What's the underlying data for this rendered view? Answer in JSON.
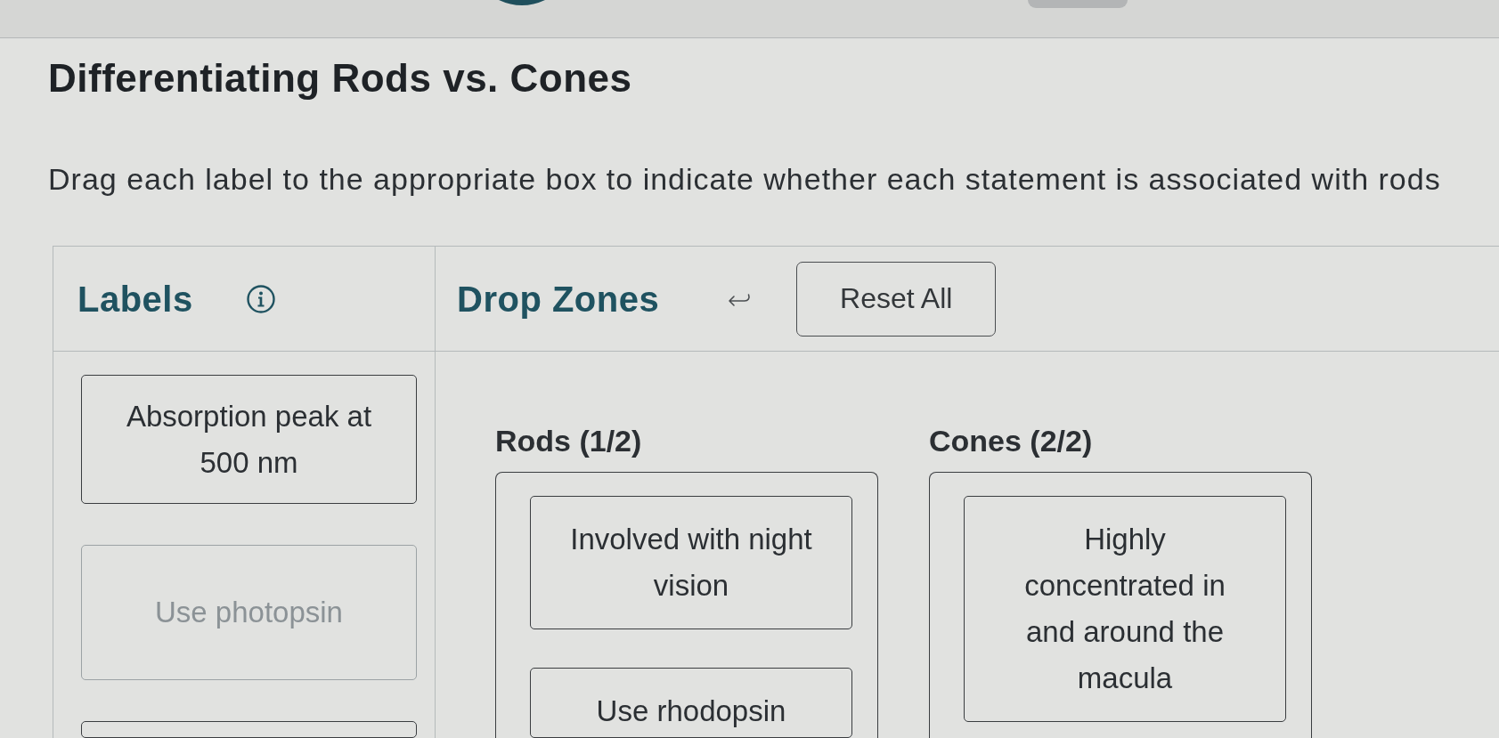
{
  "top_bar": {
    "marks": [
      {
        "kind": "circle"
      },
      {
        "kind": "tab"
      }
    ]
  },
  "title": "Differentiating Rods vs. Cones",
  "instructions": "Drag each label to the appropriate box to indicate whether each statement is associated with rods",
  "labels_panel": {
    "heading": "Labels"
  },
  "drop_zones_panel": {
    "heading": "Drop Zones",
    "reset_button": "Reset All"
  },
  "labels": [
    {
      "text": "Absorption peak at 500 nm",
      "placed": false
    },
    {
      "text": "Use photopsin",
      "placed": true
    },
    {
      "placed": false
    }
  ],
  "zones": [
    {
      "title": "Rods (1/2)",
      "items": [
        "Involved with night vision",
        "Use rhodopsin"
      ]
    },
    {
      "title": "Cones (2/2)",
      "items": [
        "Highly concentrated in and around the macula"
      ]
    }
  ]
}
